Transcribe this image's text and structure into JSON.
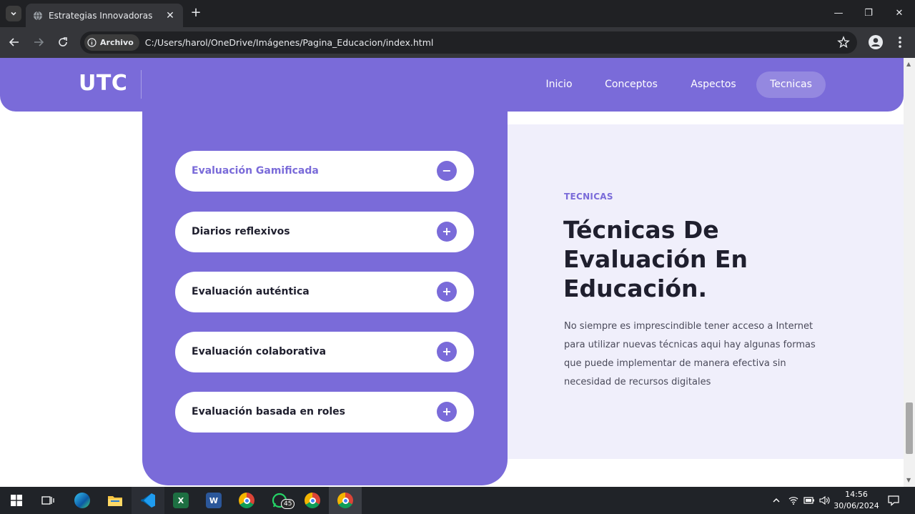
{
  "browser": {
    "tab_title": "Estrategias Innovadoras",
    "address_chip": "Archivo",
    "url": "C:/Users/harol/OneDrive/Imágenes/Pagina_Educacion/index.html"
  },
  "site": {
    "logo": "UTC",
    "nav": [
      "Inicio",
      "Conceptos",
      "Aspectos",
      "Tecnicas"
    ],
    "active_nav": "Tecnicas",
    "accent_color": "#7a6bd9"
  },
  "accordion": {
    "items": [
      {
        "label": "Evaluación Gamificada",
        "state": "expanded",
        "icon": "−"
      },
      {
        "label": "Diarios reflexivos",
        "state": "collapsed",
        "icon": "+"
      },
      {
        "label": "Evaluación auténtica",
        "state": "collapsed",
        "icon": "+"
      },
      {
        "label": "Evaluación colaborativa",
        "state": "collapsed",
        "icon": "+"
      },
      {
        "label": "Evaluación basada en roles",
        "state": "collapsed",
        "icon": "+"
      }
    ]
  },
  "content": {
    "eyebrow": "TECNICAS",
    "heading_lines": [
      "Técnicas De",
      "Evaluación En",
      "Educación."
    ],
    "description": "No siempre es imprescindible tener acceso a Internet para utilizar nuevas técnicas aqui hay algunas formas que puede implementar de manera efectiva sin necesidad de recursos digitales"
  },
  "taskbar": {
    "whatsapp_badge": "45",
    "time": "14:56",
    "date": "30/06/2024",
    "apps": [
      "windows-start",
      "task-view",
      "edge",
      "file-explorer",
      "vscode",
      "excel",
      "word",
      "chrome-profile-1",
      "whatsapp",
      "chrome-profile-2",
      "chrome"
    ]
  }
}
